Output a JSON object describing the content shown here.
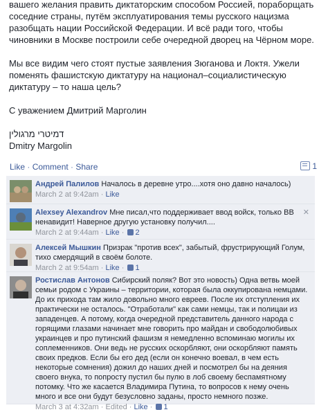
{
  "post": {
    "para1": "вашего желания править диктаторским способом Россией, пораборщать соседние страны, путём эксплуатирования темы русского нацизма разобщать нации Российской Федерации. И всё ради того, чтобы чиновники в Москве построили себе очередной дворец на Чёрном море.",
    "para2": "Мы все видим чего стоят пустые заявления Зюганова и Локтя. Ужели поменять фашистскую диктатуру на национал–социалистическую диктатуру – то наша цель?",
    "para3": "С уважением Дмитрий Марголин",
    "hebrew": "דמיטרי מרגולין",
    "latin_name": "Dmitry Margolin"
  },
  "actions": {
    "like": "Like",
    "comment": "Comment",
    "share": "Share",
    "dot": " · ",
    "comment_count": "1"
  },
  "comments": [
    {
      "name": "Андрей Палилов",
      "text": "Началось в деревне утро....хотя оно давно началось)",
      "time": "March 2 at 9:42am",
      "like": "Like",
      "likes": "",
      "edited": ""
    },
    {
      "name": "Alexsey Alexandrov",
      "text": "Мне писал,что поддерживает ввод войск, только ВВ ненавидит! Наверное другую установку получил....",
      "time": "March 2 at 9:44am",
      "like": "Like",
      "likes": "2",
      "edited": ""
    },
    {
      "name": "Алексей Мышкин",
      "text": "Призрак \"против всех\", забытый, фрустрирующий Голум, тихо смердящий в своём болоте.",
      "time": "March 2 at 9:54am",
      "like": "Like",
      "likes": "1",
      "edited": ""
    },
    {
      "name": "Ростислав Антонов",
      "text": "Сибирский поляк? Вот это новость) Одна ветвь моей семьи родом с Украины – территории, которая была оккупирована немцами. До их прихода там жило довольно много евреев. После их отступления их практически не осталось. \"Отработали\" как сами немцы, так и полицаи из западенцев. А потому, когда очередной представитель данного народа с горящими глазами начинает мне говорить про майдан и свободолюбивых украинцев и про путинский фашизм я немедленно вспоминаю могилы их соплеменников. Они ведь не русских оскорбляют, они оскорбляют память своих предков. Если бы его дед (если он конечно воевал, в чем есть некоторые сомнения) дожил до наших дней и посмотрел бы на деяния своего внука, то попросту пустил бы пулю в лоб своему беспамятному потомку. Что же касается Владимира Путина, то вопросов к нему очень много и все они будут безусловно заданы, просто немного позже.",
      "time": "March 3 at 4:32am",
      "like": "Like",
      "likes": "1",
      "edited": "Edited"
    }
  ],
  "colors": {
    "link": "#3b5998",
    "comment_bg": "#edeff4",
    "meta": "#90949c"
  }
}
